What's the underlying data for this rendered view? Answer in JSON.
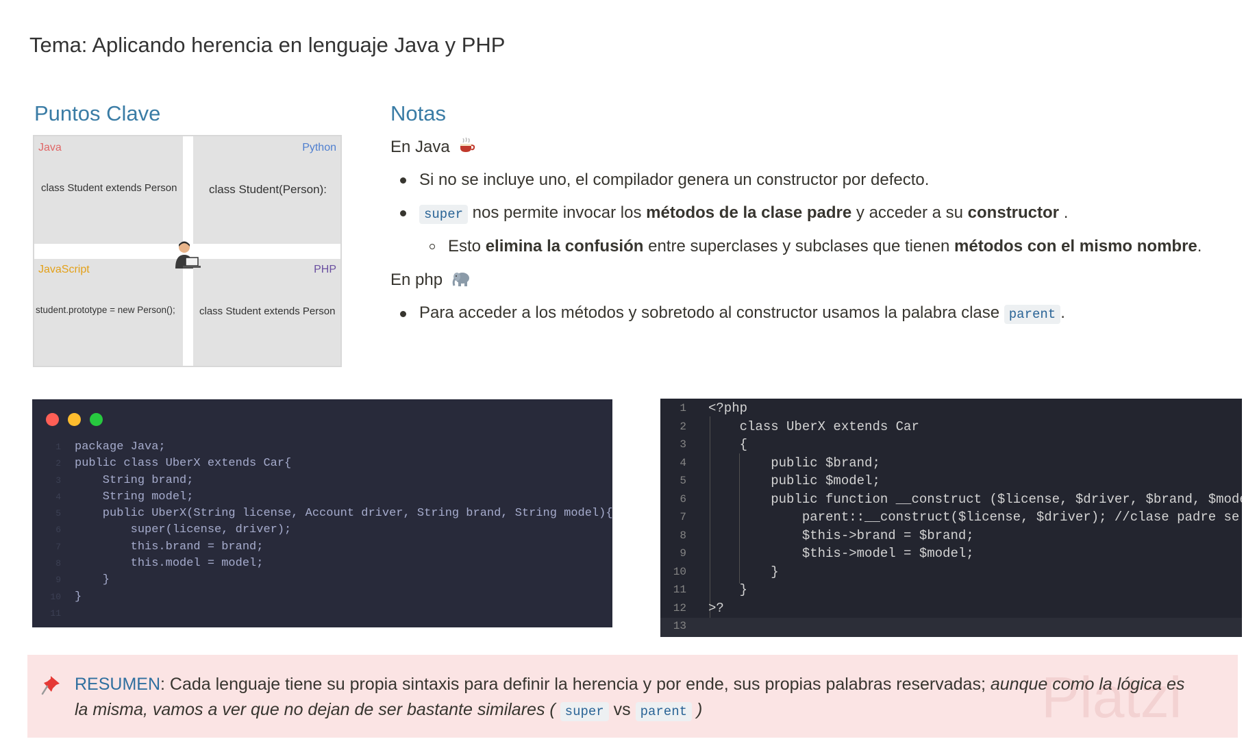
{
  "page": {
    "title": "Tema: Aplicando herencia en lenguaje Java y PHP"
  },
  "key_points": {
    "heading": "Puntos Clave",
    "diagram": {
      "java_label": "Java",
      "java_code": "class Student extends Person",
      "python_label": "Python",
      "python_code": "class Student(Person):",
      "js_label": "JavaScript",
      "js_code": "student.prototype = new Person();",
      "php_label": "PHP",
      "php_code": "class Student extends Person",
      "colors": {
        "java": "#e06666",
        "python": "#4f7fcf",
        "javascript": "#e3a018",
        "php": "#6a4fa0"
      }
    }
  },
  "notes": {
    "heading": "Notas",
    "java_title": "En Java",
    "java_icon": "coffee-icon",
    "java_b1": "Si no se incluye uno, el compilador genera un constructor por defecto.",
    "java_b2": {
      "code": "super",
      "t1": " nos permite invocar los ",
      "bold1": "métodos de la clase padre",
      "t2": " y acceder a su ",
      "bold2": "constructor",
      "t3": " ."
    },
    "java_sub": {
      "t1": "Esto ",
      "bold1": "elimina la confusión",
      "t2": " entre superclases y subclases que tienen ",
      "bold2": "métodos con el mismo nombre",
      "t3": "."
    },
    "php_title": "En php",
    "php_icon": "elephant-icon",
    "php_b1": {
      "t1": "Para acceder a los métodos y sobretodo al constructor usamos la palabra clase ",
      "code": "parent",
      "t2": "."
    }
  },
  "java_code": {
    "line_numbers": [
      "1",
      "2",
      "3",
      "4",
      "5",
      "6",
      "7",
      "8",
      "9",
      "10",
      "11"
    ],
    "lines": [
      "package Java;",
      "",
      "public class UberX extends Car{",
      "    String brand;",
      "    String model;",
      "    public UberX(String license, Account driver, String brand, String model){",
      "        super(license, driver);",
      "        this.brand = brand;",
      "        this.model = model;",
      "    }",
      "}"
    ],
    "window_dots": [
      "#ff5f56",
      "#ffbd2e",
      "#27c93f"
    ]
  },
  "php_code": {
    "line_numbers": [
      "1",
      "2",
      "3",
      "4",
      "5",
      "6",
      "7",
      "8",
      "9",
      "10",
      "11",
      "12",
      "13"
    ],
    "lines": [
      "<?php",
      "    class UberX extends Car",
      "    {",
      "        public $brand;",
      "        public $model;",
      "",
      "        public function __construct ($license, $driver, $brand, $model){",
      "            parent::__construct($license, $driver); //clase padre se inta",
      "            $this->brand = $brand;",
      "            $this->model = $model;",
      "        }",
      "    }",
      ">?"
    ]
  },
  "summary": {
    "icon": "pushpin-icon",
    "label": "RESUMEN",
    "text": ": Cada lenguaje tiene su propia sintaxis para definir la herencia y por ende, sus propias palabras reservadas; ",
    "italic": "aunque como la lógica es la misma, vamos a ver que no dejan de ser bastante similares (",
    "code1": "super",
    "vs": " vs ",
    "code2": "parent",
    "end": ")",
    "watermark": "Platzi"
  }
}
